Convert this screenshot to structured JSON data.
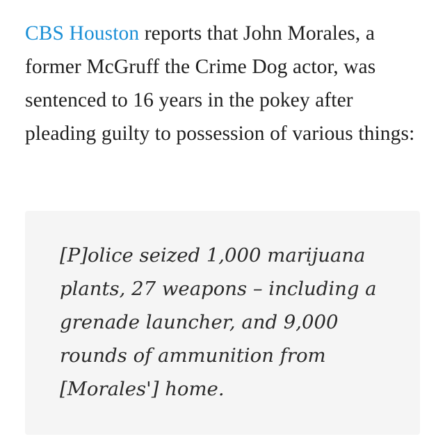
{
  "intro": {
    "link_text": "CBS Houston",
    "body_text": " reports that John Morales, a former McGruff the Crime Dog actor, was sentenced to 16 years in the pokey after pleading guilty to possession of various things:"
  },
  "blockquote": {
    "text": "[P]olice seized 1,000 marijuana plants, 27 weapons – including a grenade launcher, and 9,000 rounds of ammunition from [Morales'] home."
  },
  "colors": {
    "link": "#1a8fd6",
    "text": "#1f1f1f",
    "quote_background": "#f5f5f5"
  }
}
